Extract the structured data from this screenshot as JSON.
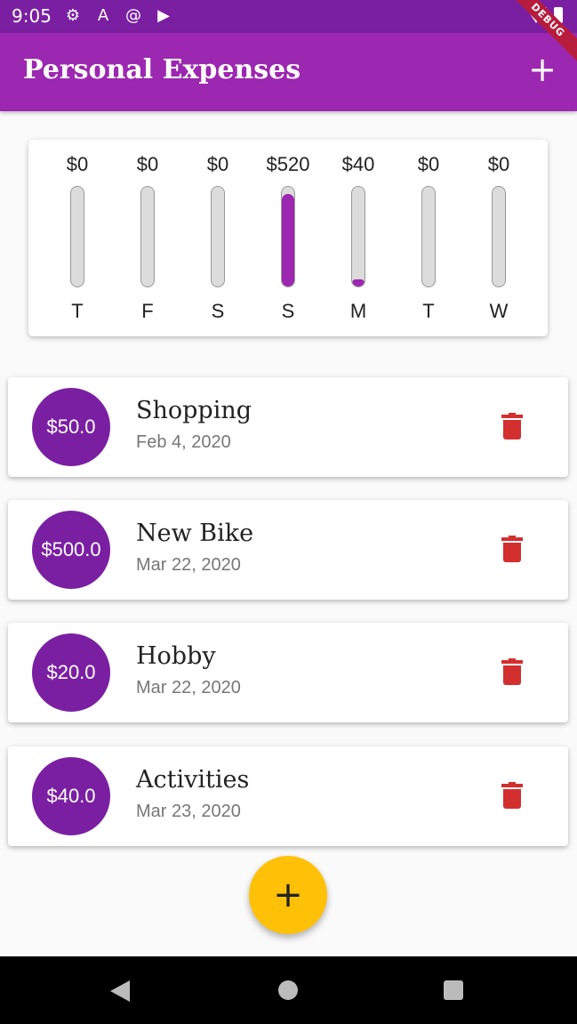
{
  "status_bar": {
    "time": "9:05",
    "icons": [
      "gear-icon",
      "a-icon",
      "at-icon",
      "play-icon"
    ],
    "debug_label": "DEBUG"
  },
  "app_bar": {
    "title": "Personal Expenses",
    "add_icon": "+"
  },
  "chart": {
    "bars": [
      {
        "day": "T",
        "amount": "$0",
        "fraction": 0
      },
      {
        "day": "F",
        "amount": "$0",
        "fraction": 0
      },
      {
        "day": "S",
        "amount": "$0",
        "fraction": 0
      },
      {
        "day": "S",
        "amount": "$520",
        "fraction": 0.93
      },
      {
        "day": "M",
        "amount": "$40",
        "fraction": 0.07
      },
      {
        "day": "T",
        "amount": "$0",
        "fraction": 0
      },
      {
        "day": "W",
        "amount": "$0",
        "fraction": 0
      }
    ]
  },
  "transactions": [
    {
      "amount": "$50.0",
      "title": "Shopping",
      "date": "Feb 4, 2020"
    },
    {
      "amount": "$500.0",
      "title": "New Bike",
      "date": "Mar 22, 2020"
    },
    {
      "amount": "$20.0",
      "title": "Hobby",
      "date": "Mar 22, 2020"
    },
    {
      "amount": "$40.0",
      "title": "Activities",
      "date": "Mar 23, 2020"
    }
  ],
  "fab": {
    "label": "+"
  },
  "colors": {
    "primary": "#9c27b0",
    "primary_dark": "#7b1fa2",
    "accent": "#ffc107",
    "delete": "#d32f2f"
  }
}
